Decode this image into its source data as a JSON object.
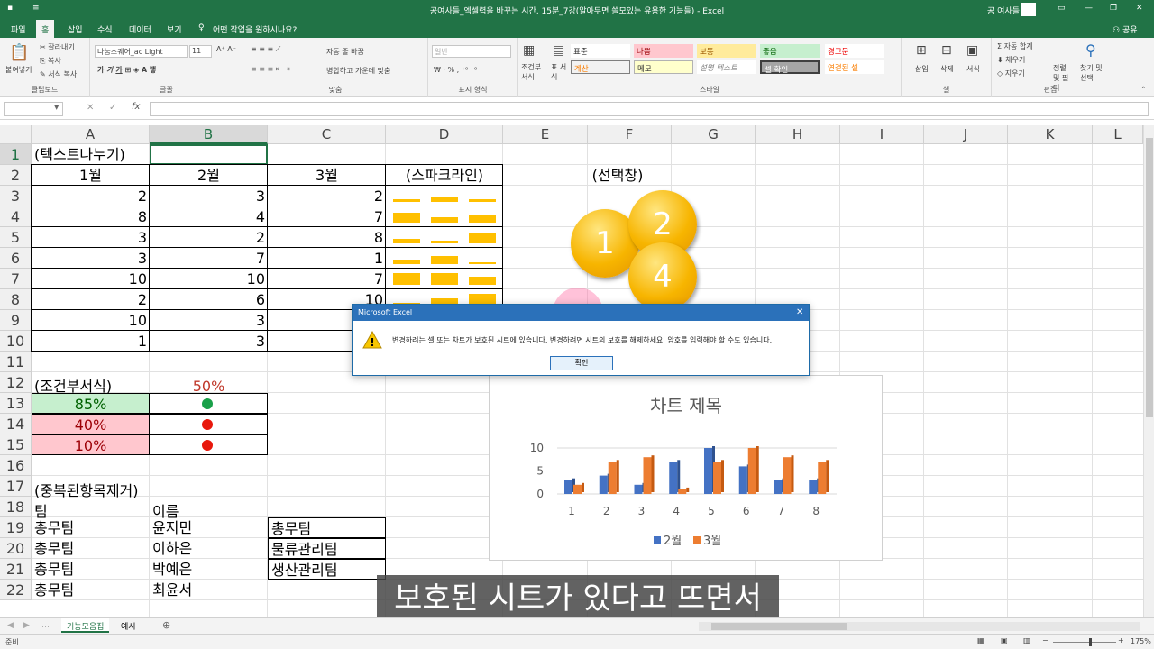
{
  "window": {
    "title": "공여사들_엑셀력을 바꾸는 시간, 15분_7강(알아두면 쓸모있는 유용한 기능들) - Excel",
    "user": "공 여사들"
  },
  "tabs": [
    "파일",
    "홈",
    "삽입",
    "수식",
    "데이터",
    "보기"
  ],
  "tell_me": "어떤 작업을 원하시나요?",
  "share": "공유",
  "ribbon": {
    "clipboard": {
      "paste": "붙여넣기",
      "cut": "잘라내기",
      "copy": "복사",
      "format_painter": "서식 복사",
      "label": "클립보드"
    },
    "font": {
      "name": "나눔스퀘어_ac Light",
      "size": "11",
      "label": "글꼴"
    },
    "alignment": {
      "wrap": "자동 줄 바꿈",
      "merge": "병합하고 가운데 맞춤",
      "label": "맞춤"
    },
    "number": {
      "format": "일반",
      "label": "표시 형식"
    },
    "styles": {
      "cond": "조건부 서식",
      "table": "표 서식",
      "cells": [
        "표준",
        "나쁨",
        "보통",
        "좋음",
        "경고문",
        "계산",
        "메모",
        "설명 텍스트",
        "셀 확인",
        "연결된 셀"
      ],
      "label": "스타일"
    },
    "cells_grp": {
      "insert": "삽입",
      "delete": "삭제",
      "format": "서식",
      "label": "셀"
    },
    "editing": {
      "autosum": "자동 합계",
      "fill": "채우기",
      "clear": "지우기",
      "sort": "정렬 및 필터",
      "find": "찾기 및 선택",
      "label": "편집"
    }
  },
  "formula_bar": {
    "name_box": "",
    "formula": ""
  },
  "columns": [
    "A",
    "B",
    "C",
    "D",
    "E",
    "F",
    "G",
    "H",
    "I",
    "J",
    "K",
    "L"
  ],
  "rows": [
    "1",
    "2",
    "3",
    "4",
    "5",
    "6",
    "7",
    "8",
    "9",
    "10",
    "11",
    "12",
    "13",
    "14",
    "15",
    "16",
    "17",
    "18",
    "19",
    "20",
    "21",
    "22"
  ],
  "sheet": {
    "a1": "(텍스트나누기)",
    "headers": [
      "1월",
      "2월",
      "3월",
      "(스파크라인)"
    ],
    "data": [
      [
        2,
        3,
        2
      ],
      [
        8,
        4,
        7
      ],
      [
        3,
        2,
        8
      ],
      [
        3,
        7,
        1
      ],
      [
        10,
        10,
        7
      ],
      [
        2,
        6,
        10
      ],
      [
        10,
        3,
        ""
      ],
      [
        1,
        3,
        ""
      ]
    ],
    "sparkline": [
      [
        2,
        3,
        2
      ],
      [
        8,
        4,
        7
      ],
      [
        3,
        2,
        8
      ],
      [
        3,
        7,
        1
      ],
      [
        10,
        10,
        7
      ],
      [
        2,
        6,
        10
      ]
    ],
    "cond_title": "(조건부서식)",
    "cond_pct": "50%",
    "cond_vals": [
      "85%",
      "40%",
      "10%"
    ],
    "cond_dots": [
      "#19a049",
      "#e8180c",
      "#e8180c"
    ],
    "dup_title": "(중복된항목제거)",
    "dup_header": [
      "팀",
      "이름"
    ],
    "dup_rows": [
      [
        "총무팀",
        "윤지민",
        "총무팀"
      ],
      [
        "총무팀",
        "이하은",
        "물류관리팀"
      ],
      [
        "총무팀",
        "박예은",
        "생산관리팀"
      ],
      [
        "총무팀",
        "최윤서",
        ""
      ]
    ],
    "select_title": "(선택창)"
  },
  "coins": [
    "1",
    "2",
    "4"
  ],
  "dialog": {
    "title": "Microsoft Excel",
    "message": "변경하려는 셀 또는 차트가 보호된 시트에 있습니다. 변경하려면 시트의 보호를 해제하세요. 암호를 입력해야 할 수도 있습니다.",
    "ok": "확인"
  },
  "chart_data": {
    "type": "bar",
    "title": "차트 제목",
    "categories": [
      "1",
      "2",
      "3",
      "4",
      "5",
      "6",
      "7",
      "8"
    ],
    "series": [
      {
        "name": "2월",
        "values": [
          3,
          4,
          2,
          7,
          10,
          6,
          3,
          3
        ],
        "color": "#4472c4"
      },
      {
        "name": "3월",
        "values": [
          2,
          7,
          8,
          1,
          7,
          10,
          8,
          7
        ],
        "color": "#ed7d31"
      }
    ],
    "yticks": [
      "10",
      "5",
      "0"
    ],
    "ylim": [
      0,
      10
    ]
  },
  "sheet_tabs": [
    "기능모음집",
    "예시"
  ],
  "status": {
    "ready": "준비",
    "zoom": "175%"
  },
  "subtitle": "보호된 시트가 있다고 뜨면서"
}
